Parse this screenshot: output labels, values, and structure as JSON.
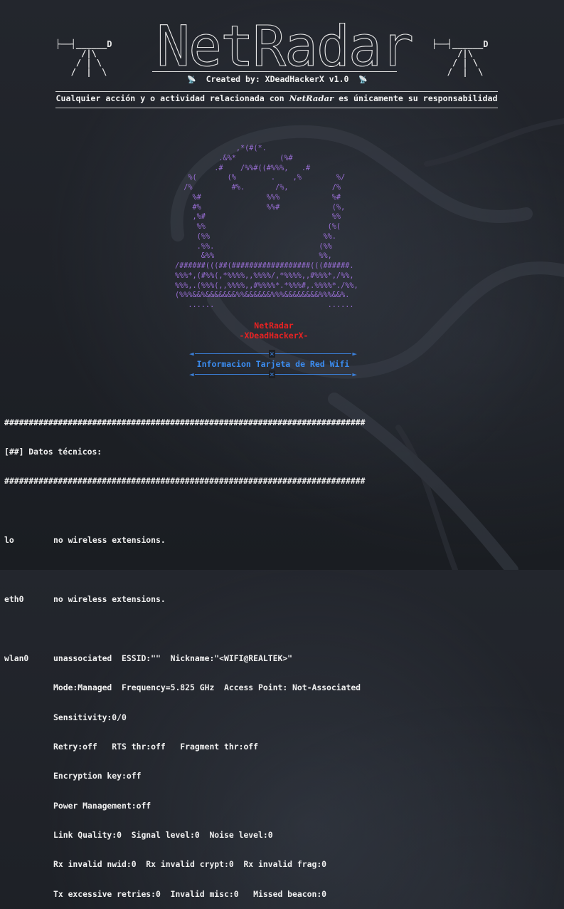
{
  "logo": {
    "text": "NetRadar"
  },
  "created_by": {
    "label": "Created by: XDeadHackerX v1.0"
  },
  "towers": {
    "art": "├──┤______D\n     /|\\\n    / | \\\n   /  |  \\"
  },
  "disclaimer": {
    "prefix": "Cualquier acción y o actividad relacionada con ",
    "brand": "NetRadar",
    "suffix": " es únicamente su responsabilidad"
  },
  "radar_art": "              ,*(#(*.\n          .&%*          (%#\n         .#    /%%#((#%%%,   .#\n   %(       (%        .    ,%        %/\n  /%         #%.       /%,          /%\n    %#               %%%            %#\n    #%               %%#            (%,\n    ,%#                             %%\n     %%                            (%(\n     (%%                          %%.\n     .%%.                        (%%\n      &%%                        %%,\n/######(((##(##################(((######.\n%%%*,(#%%(,*%%%%,,%%%%/,*%%%%,,#%%%*,/%%,\n%%%,.(%%%(,,%%%%,,#%%%%*.*%%%#,.%%%%*./%%,\n(%%%&&%&&&&&&&%%&&&&&&%%%&&&&&&&&%%%&&%.\n   ......                          ......",
  "brand": {
    "name": "NetRadar",
    "author": "-XDeadHackerX-"
  },
  "info": {
    "title": "Informacion Tarjeta de Red Wifi"
  },
  "terminal": {
    "separator": "##########################################################################",
    "section_title": "[##] Datos técnicos:",
    "lo": {
      "name": "lo",
      "value": "no wireless extensions."
    },
    "eth0": {
      "name": "eth0",
      "value": "no wireless extensions."
    },
    "wlan0": {
      "name": "wlan0",
      "lines": [
        "unassociated  ESSID:\"\"  Nickname:\"<WIFI@REALTEK>\"",
        "Mode:Managed  Frequency=5.825 GHz  Access Point: Not-Associated",
        "Sensitivity:0/0",
        "Retry:off   RTS thr:off   Fragment thr:off",
        "Encryption key:off",
        "Power Management:off",
        "Link Quality:0  Signal level:0  Noise level:0",
        "Rx invalid nwid:0  Rx invalid crypt:0  Rx invalid frag:0",
        "Tx excessive retries:0  Invalid misc:0   Missed beacon:0"
      ]
    }
  },
  "colors": {
    "background": "#1b1e24",
    "radar": "#9a6fd6",
    "brand_red": "#e82222",
    "info_blue": "#3b8cf0",
    "text": "#f0f0f0"
  }
}
